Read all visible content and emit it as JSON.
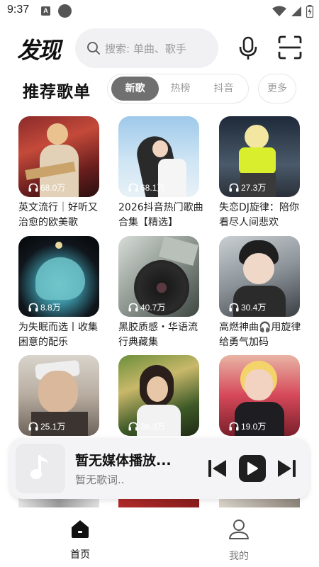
{
  "status_bar": {
    "time": "9:37",
    "a_badge": "A"
  },
  "header": {
    "logo": "发现",
    "search_placeholder": "搜索: 单曲、歌手"
  },
  "section": {
    "title": "推荐歌单",
    "tabs": [
      "新歌",
      "热榜",
      "抖音"
    ],
    "active_tab": "新歌",
    "more_label": "更多"
  },
  "playlists": [
    {
      "title": "英文流行｜好听又治愈的欧美歌",
      "plays": "68.0万"
    },
    {
      "title": "2026抖音热门歌曲合集【精选】",
      "plays": "68.1万"
    },
    {
      "title": "失恋DJ旋律：陪你看尽人间悲欢",
      "plays": "27.3万"
    },
    {
      "title": "为失眠而选丨收集困意的配乐",
      "plays": "8.8万"
    },
    {
      "title": "黑胶质感・华语流行典藏集",
      "plays": "40.7万"
    },
    {
      "title": "高燃神曲🎧用旋律给勇气加码",
      "plays": "30.4万"
    },
    {
      "title": "",
      "plays": "25.1万"
    },
    {
      "title": "",
      "plays": "36.3万"
    },
    {
      "title": "",
      "plays": "19.0万"
    }
  ],
  "player": {
    "title": "暂无媒体播放...",
    "lyric": "暂无歌词.."
  },
  "bottom_nav": [
    {
      "label": "首页",
      "active": true
    },
    {
      "label": "我的",
      "active": false
    }
  ],
  "colors": {
    "accent": "#1f1f1f",
    "tab_active_bg": "#707070",
    "inactive_text": "#9a9a9a"
  }
}
